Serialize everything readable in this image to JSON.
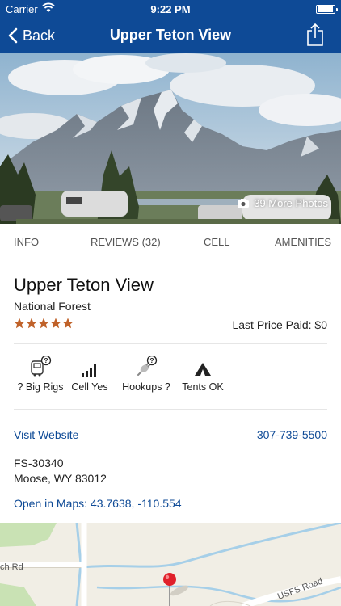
{
  "status_bar": {
    "carrier": "Carrier",
    "time": "9:22 PM"
  },
  "nav": {
    "back_label": "Back",
    "title": "Upper Teton View"
  },
  "hero": {
    "more_photos": "39 More Photos"
  },
  "tabs": [
    {
      "label": "INFO"
    },
    {
      "label": "REVIEWS (32)"
    },
    {
      "label": "CELL"
    },
    {
      "label": "AMENITIES"
    }
  ],
  "campsite": {
    "name": "Upper Teton View",
    "type": "National Forest",
    "rating": 5,
    "star_color": "#c0622a",
    "last_price": "Last Price Paid: $0"
  },
  "features": [
    {
      "label": "? Big Rigs",
      "icon": "rv-question-icon"
    },
    {
      "label": "Cell Yes",
      "icon": "signal-bars-icon"
    },
    {
      "label": "Hookups ?",
      "icon": "plug-question-icon"
    },
    {
      "label": "Tents OK",
      "icon": "tent-icon"
    }
  ],
  "contact": {
    "website": "Visit Website",
    "phone": "307-739-5500",
    "address_line1": "FS-30340",
    "address_line2": "Moose, WY 83012",
    "maps_link": "Open in Maps: 43.7638, -110.554"
  },
  "map": {
    "road_left": "ch Rd",
    "road_right": "USFS Road"
  },
  "colors": {
    "nav_bg": "#0e4a96",
    "link": "#0e4a96"
  }
}
